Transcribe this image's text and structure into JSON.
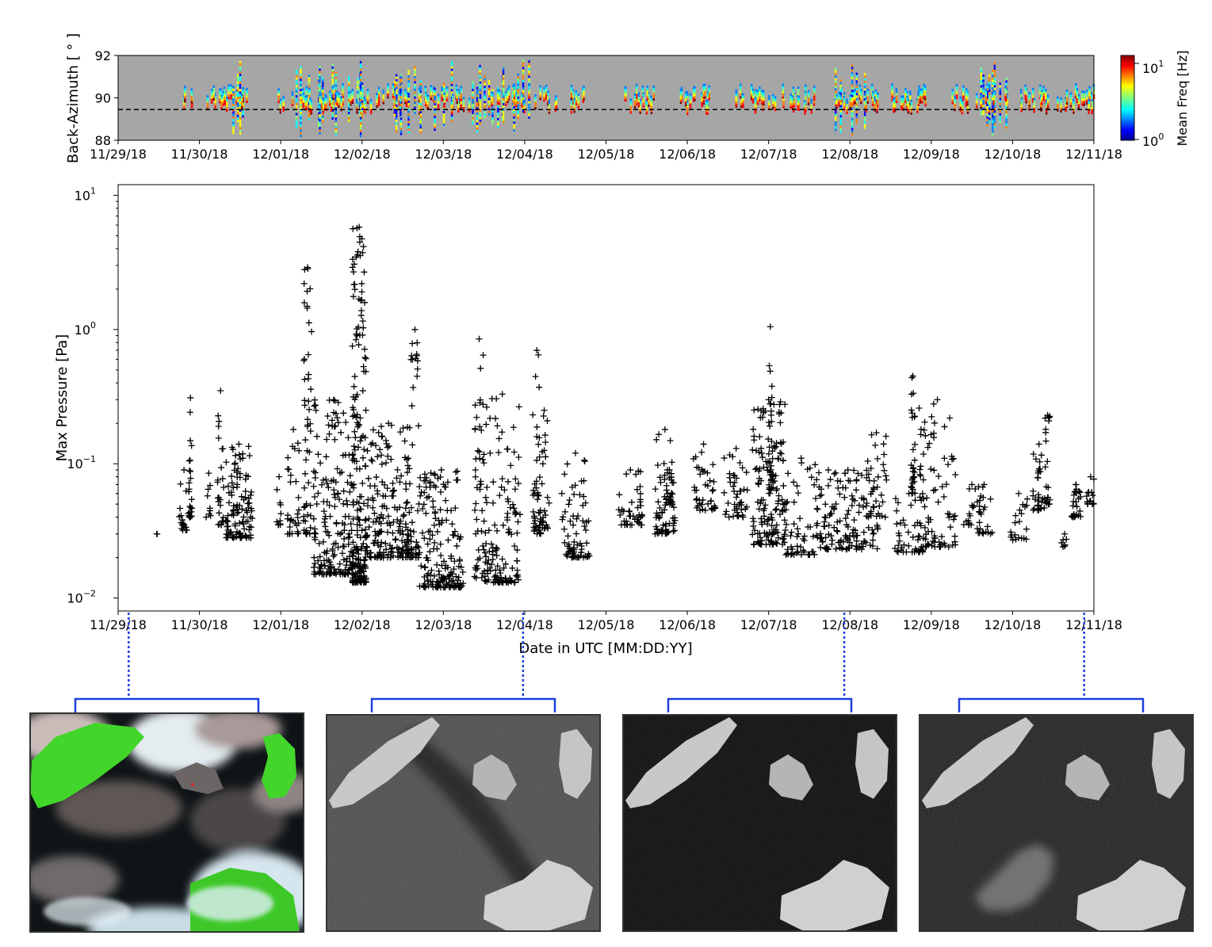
{
  "chart_data": [
    {
      "type": "scatter",
      "ylabel": "Back-Azimuth [ ° ]",
      "xlabel": "",
      "xlim": [
        "11/29/18",
        "12/11/18"
      ],
      "ylim": [
        88,
        92
      ],
      "yticks": [
        88,
        90,
        92
      ],
      "xticklabels": [
        "11/29/18",
        "11/30/18",
        "12/01/18",
        "12/02/18",
        "12/03/18",
        "12/04/18",
        "12/05/18",
        "12/06/18",
        "12/07/18",
        "12/08/18",
        "12/09/18",
        "12/10/18",
        "12/11/18"
      ],
      "reference_line": {
        "y": 89.45,
        "style": "dashed",
        "color": "#000000"
      },
      "background_color": "#a6a6a6",
      "colorbar": {
        "label": "Mean Freq [Hz]",
        "scale": "log",
        "range": [
          1,
          15
        ],
        "ticklabels": [
          "10",
          "10"
        ],
        "tickexponents": [
          "1",
          "0"
        ],
        "colormap": "jet"
      },
      "activity_windows": [
        {
          "day": 0.78,
          "dur": 0.05,
          "level": "high"
        },
        {
          "day": 0.88,
          "dur": 0.03,
          "level": "mid"
        },
        {
          "day": 1.1,
          "dur": 0.25,
          "level": "mid"
        },
        {
          "day": 1.25,
          "dur": 0.35,
          "level": "mid"
        },
        {
          "day": 1.97,
          "dur": 0.1,
          "level": "mid"
        },
        {
          "day": 2.1,
          "dur": 0.5,
          "level": "high"
        },
        {
          "day": 2.6,
          "dur": 0.65,
          "level": "high"
        },
        {
          "day": 3.25,
          "dur": 0.8,
          "level": "high"
        },
        {
          "day": 4.0,
          "dur": 0.3,
          "level": "mid"
        },
        {
          "day": 4.3,
          "dur": 0.55,
          "level": "mid"
        },
        {
          "day": 4.85,
          "dur": 0.55,
          "level": "mid"
        },
        {
          "day": 5.55,
          "dur": 0.2,
          "level": "low"
        },
        {
          "day": 6.2,
          "dur": 0.4,
          "level": "low"
        },
        {
          "day": 6.9,
          "dur": 0.4,
          "level": "low"
        },
        {
          "day": 7.6,
          "dur": 0.5,
          "level": "low"
        },
        {
          "day": 8.15,
          "dur": 0.45,
          "level": "low"
        },
        {
          "day": 8.8,
          "dur": 0.4,
          "level": "mid"
        },
        {
          "day": 9.15,
          "dur": 0.2,
          "level": "low"
        },
        {
          "day": 9.5,
          "dur": 0.35,
          "level": "low"
        },
        {
          "day": 9.8,
          "dur": 0.2,
          "level": "low"
        },
        {
          "day": 10.25,
          "dur": 0.25,
          "level": "mid"
        },
        {
          "day": 10.55,
          "dur": 0.4,
          "level": "mid"
        },
        {
          "day": 11.1,
          "dur": 0.4,
          "level": "low"
        },
        {
          "day": 11.55,
          "dur": 0.45,
          "level": "low"
        }
      ]
    },
    {
      "type": "scatter",
      "marker": "+",
      "color": "#000000",
      "xlabel": "Date in UTC [MM:DD:YY]",
      "ylabel": "Max Pressure [Pa]",
      "yscale": "log",
      "xlim": [
        "11/29/18",
        "12/11/18"
      ],
      "ylim": [
        0.008,
        12
      ],
      "yticklabels": [
        "10",
        "10",
        "10",
        "10"
      ],
      "ytickexponents": [
        "1",
        "0",
        "−1",
        "−2"
      ],
      "xticklabels": [
        "11/29/18",
        "11/30/18",
        "12/01/18",
        "12/02/18",
        "12/03/18",
        "12/04/18",
        "12/05/18",
        "12/06/18",
        "12/07/18",
        "12/08/18",
        "12/09/18",
        "12/10/18",
        "12/11/18"
      ],
      "clusters": [
        {
          "day": 0.47,
          "dur": 0.01,
          "n": 1,
          "lo": 0.029,
          "hi": 0.03
        },
        {
          "day": 0.75,
          "dur": 0.12,
          "n": 18,
          "lo": 0.032,
          "hi": 0.09
        },
        {
          "day": 0.87,
          "dur": 0.04,
          "n": 22,
          "lo": 0.04,
          "hi": 0.31
        },
        {
          "day": 1.08,
          "dur": 0.07,
          "n": 8,
          "lo": 0.04,
          "hi": 0.085
        },
        {
          "day": 1.22,
          "dur": 0.08,
          "n": 24,
          "lo": 0.035,
          "hi": 0.35
        },
        {
          "day": 1.32,
          "dur": 0.33,
          "n": 110,
          "lo": 0.028,
          "hi": 0.14
        },
        {
          "day": 1.95,
          "dur": 0.06,
          "n": 10,
          "lo": 0.035,
          "hi": 0.08
        },
        {
          "day": 2.08,
          "dur": 0.15,
          "n": 30,
          "lo": 0.03,
          "hi": 0.18
        },
        {
          "day": 2.28,
          "dur": 0.1,
          "n": 50,
          "lo": 0.03,
          "hi": 2.9
        },
        {
          "day": 2.4,
          "dur": 0.5,
          "n": 190,
          "lo": 0.015,
          "hi": 0.3
        },
        {
          "day": 2.88,
          "dur": 0.17,
          "n": 200,
          "lo": 0.013,
          "hi": 5.8
        },
        {
          "day": 3.05,
          "dur": 0.55,
          "n": 190,
          "lo": 0.02,
          "hi": 0.2
        },
        {
          "day": 3.6,
          "dur": 0.1,
          "n": 40,
          "lo": 0.02,
          "hi": 1.0
        },
        {
          "day": 3.7,
          "dur": 0.55,
          "n": 170,
          "lo": 0.012,
          "hi": 0.09
        },
        {
          "day": 4.38,
          "dur": 0.12,
          "n": 45,
          "lo": 0.014,
          "hi": 0.85
        },
        {
          "day": 4.5,
          "dur": 0.45,
          "n": 130,
          "lo": 0.013,
          "hi": 0.33
        },
        {
          "day": 5.1,
          "dur": 0.1,
          "n": 40,
          "lo": 0.03,
          "hi": 0.7
        },
        {
          "day": 5.18,
          "dur": 0.12,
          "n": 30,
          "lo": 0.033,
          "hi": 0.25
        },
        {
          "day": 5.45,
          "dur": 0.35,
          "n": 70,
          "lo": 0.02,
          "hi": 0.12
        },
        {
          "day": 6.15,
          "dur": 0.3,
          "n": 45,
          "lo": 0.035,
          "hi": 0.09
        },
        {
          "day": 6.6,
          "dur": 0.25,
          "n": 55,
          "lo": 0.03,
          "hi": 0.18
        },
        {
          "day": 6.72,
          "dur": 0.12,
          "n": 25,
          "lo": 0.05,
          "hi": 0.09
        },
        {
          "day": 7.05,
          "dur": 0.3,
          "n": 40,
          "lo": 0.045,
          "hi": 0.14
        },
        {
          "day": 7.45,
          "dur": 0.3,
          "n": 45,
          "lo": 0.04,
          "hi": 0.13
        },
        {
          "day": 7.8,
          "dur": 0.4,
          "n": 150,
          "lo": 0.025,
          "hi": 0.3
        },
        {
          "day": 8.0,
          "dur": 0.04,
          "n": 30,
          "lo": 0.06,
          "hi": 1.05
        },
        {
          "day": 8.2,
          "dur": 0.4,
          "n": 60,
          "lo": 0.021,
          "hi": 0.11
        },
        {
          "day": 8.6,
          "dur": 0.75,
          "n": 140,
          "lo": 0.023,
          "hi": 0.09
        },
        {
          "day": 9.2,
          "dur": 0.25,
          "n": 35,
          "lo": 0.04,
          "hi": 0.17
        },
        {
          "day": 9.55,
          "dur": 0.35,
          "n": 40,
          "lo": 0.022,
          "hi": 0.06
        },
        {
          "day": 9.75,
          "dur": 0.05,
          "n": 30,
          "lo": 0.06,
          "hi": 0.45
        },
        {
          "day": 9.85,
          "dur": 0.45,
          "n": 90,
          "lo": 0.024,
          "hi": 0.3
        },
        {
          "day": 10.4,
          "dur": 0.2,
          "n": 20,
          "lo": 0.035,
          "hi": 0.07
        },
        {
          "day": 10.55,
          "dur": 0.2,
          "n": 20,
          "lo": 0.03,
          "hi": 0.07
        },
        {
          "day": 10.95,
          "dur": 0.25,
          "n": 20,
          "lo": 0.027,
          "hi": 0.06
        },
        {
          "day": 11.25,
          "dur": 0.15,
          "n": 30,
          "lo": 0.045,
          "hi": 0.14
        },
        {
          "day": 11.4,
          "dur": 0.06,
          "n": 20,
          "lo": 0.05,
          "hi": 0.23
        },
        {
          "day": 11.6,
          "dur": 0.08,
          "n": 6,
          "lo": 0.024,
          "hi": 0.03
        },
        {
          "day": 11.72,
          "dur": 0.12,
          "n": 25,
          "lo": 0.04,
          "hi": 0.07
        },
        {
          "day": 11.9,
          "dur": 0.12,
          "n": 15,
          "lo": 0.05,
          "hi": 0.08
        }
      ]
    }
  ],
  "image_links": [
    {
      "date_day": 0.13,
      "kind": "color"
    },
    {
      "date_day": 4.98,
      "kind": "sar"
    },
    {
      "date_day": 8.93,
      "kind": "sar"
    },
    {
      "date_day": 11.88,
      "kind": "sar"
    }
  ],
  "colors": {
    "link": "#1f3fdc",
    "panel_bg_gray": "#a6a6a6",
    "vegetation_green": "#43d62a",
    "cloud": "#d7e3e8",
    "sar_land": "#cfcfcf"
  }
}
